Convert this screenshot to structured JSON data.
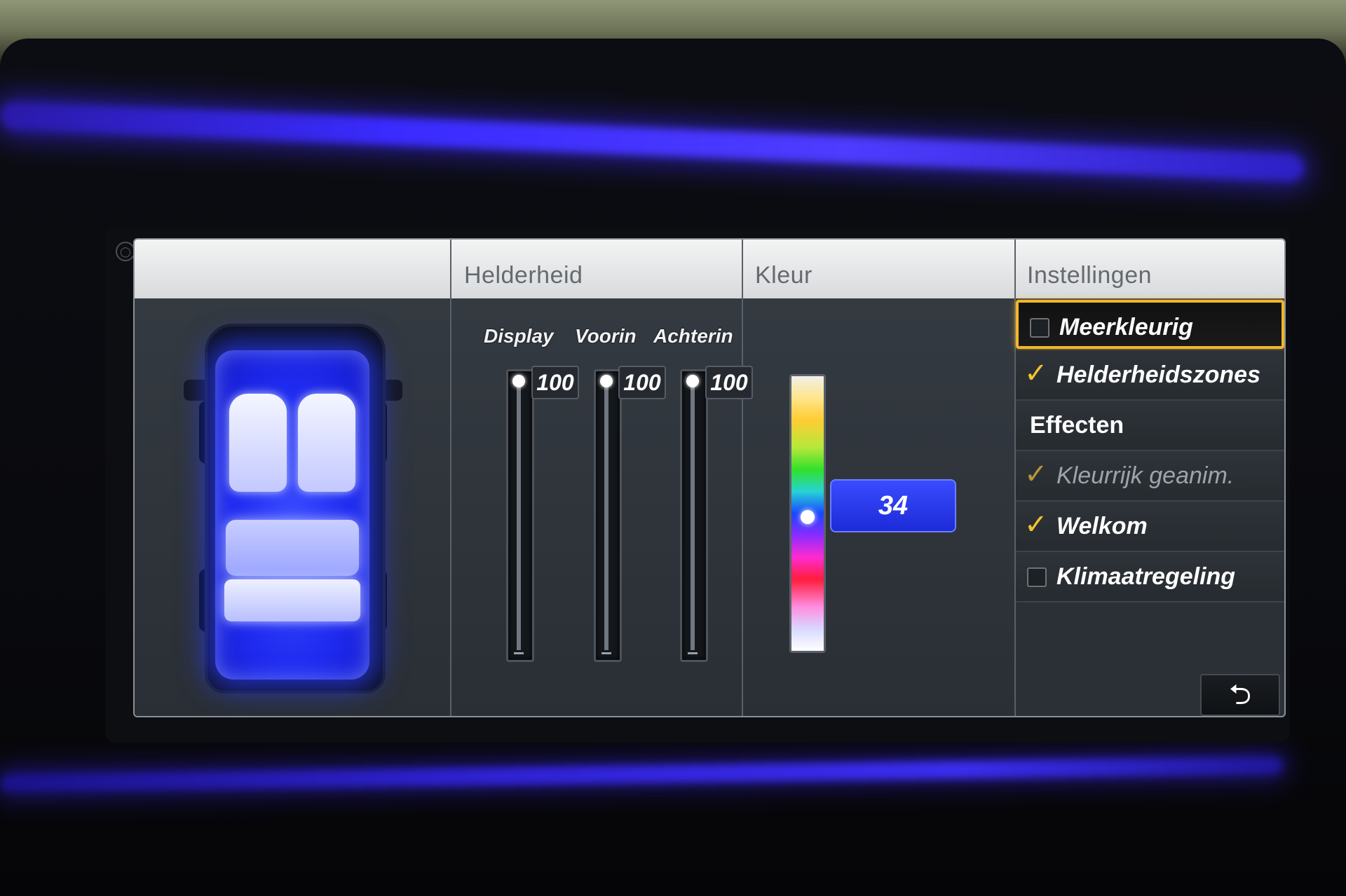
{
  "header": {
    "helderheid": "Helderheid",
    "kleur": "Kleur",
    "instellingen": "Instellingen"
  },
  "sliders": [
    {
      "label": "Display",
      "value": "100",
      "level": 1.0
    },
    {
      "label": "Voorin",
      "value": "100",
      "level": 1.0
    },
    {
      "label": "Achterin",
      "value": "100",
      "level": 1.0
    }
  ],
  "color": {
    "value": "34",
    "level": 0.52
  },
  "settings": {
    "items": [
      {
        "label": "Meerkleurig",
        "checked": false,
        "selected": true,
        "type": "checkbox"
      },
      {
        "label": "Helderheidszones",
        "checked": true,
        "type": "checkbox"
      },
      {
        "label": "Effecten",
        "type": "heading"
      },
      {
        "label": "Kleurrijk geanim.",
        "checked": true,
        "disabled": true,
        "type": "checkbox"
      },
      {
        "label": "Welkom",
        "checked": true,
        "type": "checkbox"
      },
      {
        "label": "Klimaatregeling",
        "checked": false,
        "type": "checkbox"
      }
    ],
    "back_icon": "back-arrow-icon"
  },
  "colors": {
    "accent_yellow": "#f0b62a",
    "ambient_blue": "#3a2bff"
  }
}
